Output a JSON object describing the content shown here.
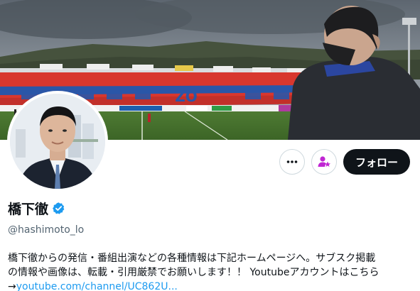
{
  "profile": {
    "display_name": "橋下徹",
    "handle": "@hashimoto_lo",
    "verified": true,
    "bio_lines": [
      "橋下徹からの発信・番組出演などの各種情報は下記ホームページへ。サブスク掲載",
      "の情報や画像は、転載・引用厳禁でお願いします！！ Youtubeアカウントはこちら",
      "→"
    ],
    "bio_link": "youtube.com/channel/UC862U..."
  },
  "actions": {
    "follow_label": "フォロー",
    "more_icon": "more-horizontal-icon",
    "subscribe_icon": "person-star-icon"
  },
  "banner": {
    "stadium_board_text": "ZO"
  },
  "colors": {
    "accent": "#1d9bf0",
    "follow_bg": "#0f1419",
    "subscribe_icon": "#c026d3",
    "verified_badge": "#1d9bf0",
    "text_secondary": "#536471"
  }
}
